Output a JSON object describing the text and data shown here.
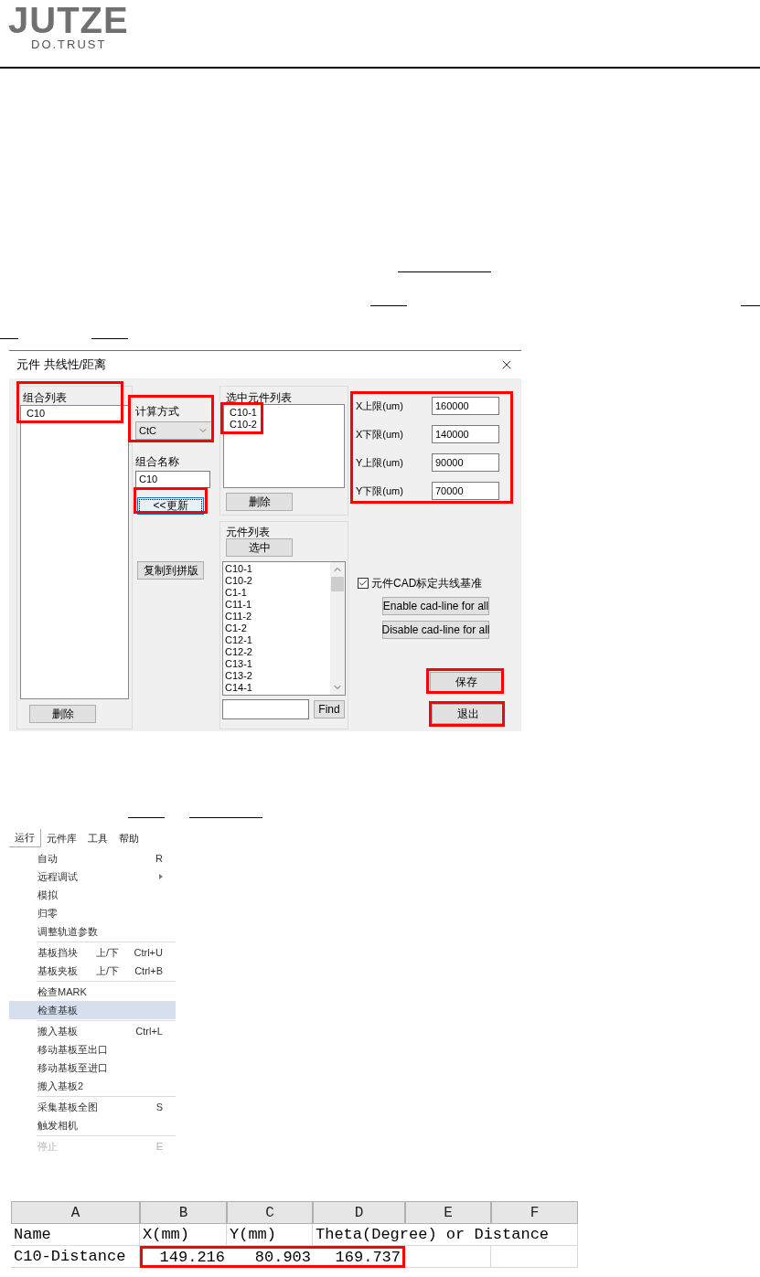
{
  "logo": {
    "wordmark": "JUTZE",
    "tagline": "DO.TRUST"
  },
  "dialog": {
    "title": "元件 共线性/距离",
    "group_list": {
      "label": "组合列表",
      "highlighted": true,
      "items": [
        {
          "text": "C10"
        }
      ],
      "delete_button": "删除"
    },
    "calc_method": {
      "label": "计算方式",
      "value": "CtC",
      "highlighted": true
    },
    "group_name": {
      "label": "组合名称",
      "value": "C10"
    },
    "update_button": {
      "label": "<<更新",
      "highlighted": true
    },
    "copy_button": "复制到拼版",
    "selected_list": {
      "label": "选中元件列表",
      "highlighted": true,
      "items": [
        "C10-1",
        "C10-2"
      ],
      "delete_button": "删除"
    },
    "component_list": {
      "label": "元件列表",
      "select_button": "选中",
      "items": [
        "C10-1",
        "C10-2",
        "C1-1",
        "C11-1",
        "C11-2",
        "C1-2",
        "C12-1",
        "C12-2",
        "C13-1",
        "C13-2",
        "C14-1"
      ],
      "find_button": "Find"
    },
    "limits": {
      "highlighted": true,
      "fields": [
        {
          "label": "X上限(um)",
          "value": "160000"
        },
        {
          "label": "X下限(um)",
          "value": "140000"
        },
        {
          "label": "Y上限(um)",
          "value": "90000"
        },
        {
          "label": "Y下限(um)",
          "value": "70000"
        }
      ]
    },
    "cad_checkbox": {
      "label": "元件CAD标定共线基准",
      "checked": true
    },
    "enable_button": "Enable cad-line for all",
    "disable_button": "Disable cad-line for all",
    "save_button": {
      "label": "保存",
      "highlighted": true
    },
    "exit_button": {
      "label": "退出",
      "highlighted": true
    }
  },
  "menu": {
    "menubar": [
      {
        "label": "运行",
        "selected": true
      },
      {
        "label": "元件库",
        "selected": false
      },
      {
        "label": "工具",
        "selected": false
      },
      {
        "label": "帮助",
        "selected": false
      }
    ],
    "items": [
      {
        "kind": "item",
        "label": "自动",
        "shortcut": "R",
        "selected": false,
        "disabled": false
      },
      {
        "kind": "item",
        "label": "远程调试",
        "submenu": true,
        "selected": false,
        "disabled": false
      },
      {
        "kind": "item",
        "label": "模拟",
        "selected": false,
        "disabled": false
      },
      {
        "kind": "item",
        "label": "归零",
        "selected": false,
        "disabled": false
      },
      {
        "kind": "item",
        "label": "调整轨道参数",
        "selected": false,
        "disabled": false
      },
      {
        "kind": "separator"
      },
      {
        "kind": "item",
        "label": "基板挡块",
        "hint": "上/下",
        "shortcut": "Ctrl+U",
        "selected": false,
        "disabled": false
      },
      {
        "kind": "item",
        "label": "基板夹板",
        "hint": "上/下",
        "shortcut": "Ctrl+B",
        "selected": false,
        "disabled": false
      },
      {
        "kind": "separator"
      },
      {
        "kind": "item",
        "label": "检查MARK",
        "selected": false,
        "disabled": false
      },
      {
        "kind": "item",
        "label": "检查基板",
        "selected": true,
        "disabled": false
      },
      {
        "kind": "separator"
      },
      {
        "kind": "item",
        "label": "搬入基板",
        "shortcut": "Ctrl+L",
        "selected": false,
        "disabled": false
      },
      {
        "kind": "item",
        "label": "移动基板至出口",
        "selected": false,
        "disabled": false
      },
      {
        "kind": "item",
        "label": "移动基板至进口",
        "selected": false,
        "disabled": false
      },
      {
        "kind": "item",
        "label": "搬入基板2",
        "selected": false,
        "disabled": false
      },
      {
        "kind": "separator"
      },
      {
        "kind": "item",
        "label": "采集基板全图",
        "shortcut": "S",
        "selected": false,
        "disabled": false
      },
      {
        "kind": "item",
        "label": "触发相机",
        "selected": false,
        "disabled": false
      },
      {
        "kind": "separator"
      },
      {
        "kind": "item",
        "label": "停止",
        "shortcut": "E",
        "selected": false,
        "disabled": true
      }
    ]
  },
  "spreadsheet": {
    "columns": [
      "A",
      "B",
      "C",
      "D",
      "E",
      "F"
    ],
    "rows": [
      [
        {
          "text": "Name",
          "highlighted": false
        },
        {
          "text": "X(mm)",
          "highlighted": false
        },
        {
          "text": "Y(mm)",
          "highlighted": false
        },
        {
          "text": "Theta(Degree) or Distance",
          "highlighted": false
        }
      ],
      [
        {
          "text": "C10-Distance",
          "highlighted": false
        },
        {
          "text": "149.216",
          "highlighted": true
        },
        {
          "text": "80.903",
          "highlighted": true
        },
        {
          "text": "169.737",
          "highlighted": true
        }
      ]
    ]
  }
}
